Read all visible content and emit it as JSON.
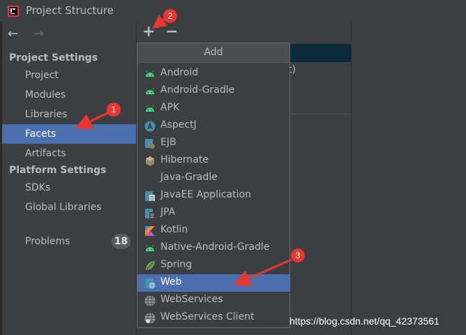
{
  "window": {
    "title": "Project Structure"
  },
  "nav": {
    "back": "←",
    "forward": "→"
  },
  "sidebar": {
    "project_settings_heading": "Project Settings",
    "platform_settings_heading": "Platform Settings",
    "items": [
      {
        "label": "Project"
      },
      {
        "label": "Modules"
      },
      {
        "label": "Libraries"
      },
      {
        "label": "Facets"
      },
      {
        "label": "Artifacts"
      },
      {
        "label": "SDKs"
      },
      {
        "label": "Global Libraries"
      },
      {
        "label": "Problems",
        "badge": "18"
      }
    ],
    "selected": "Facets"
  },
  "toolbar": {
    "add": "+",
    "remove": "−"
  },
  "middle": {
    "partial_text": "t)"
  },
  "popup": {
    "header": "Add",
    "items": [
      {
        "label": "Android",
        "icon": "android-icon"
      },
      {
        "label": "Android-Gradle",
        "icon": "android-icon"
      },
      {
        "label": "APK",
        "icon": "android-icon"
      },
      {
        "label": "AspectJ",
        "icon": "aspectj-icon"
      },
      {
        "label": "EJB",
        "icon": "ejb-icon"
      },
      {
        "label": "Hibernate",
        "icon": "hibernate-icon"
      },
      {
        "label": "Java-Gradle",
        "icon": ""
      },
      {
        "label": "JavaEE Application",
        "icon": "javaee-icon"
      },
      {
        "label": "JPA",
        "icon": "jpa-icon"
      },
      {
        "label": "Kotlin",
        "icon": "kotlin-icon"
      },
      {
        "label": "Native-Android-Gradle",
        "icon": "android-icon"
      },
      {
        "label": "Spring",
        "icon": "spring-icon"
      },
      {
        "label": "Web",
        "icon": "web-icon"
      },
      {
        "label": "WebServices",
        "icon": "webservices-icon"
      },
      {
        "label": "WebServices Client",
        "icon": "webservices-client-icon"
      }
    ],
    "selected": "Web"
  },
  "annotations": {
    "markers": [
      "1",
      "2",
      "3"
    ],
    "color": "#e8372f"
  },
  "watermark": "https://blog.csdn.net/qq_42373561",
  "colors": {
    "selection": "#4b6eaf",
    "background": "#3c3f41",
    "android_green": "#3ddc84"
  }
}
